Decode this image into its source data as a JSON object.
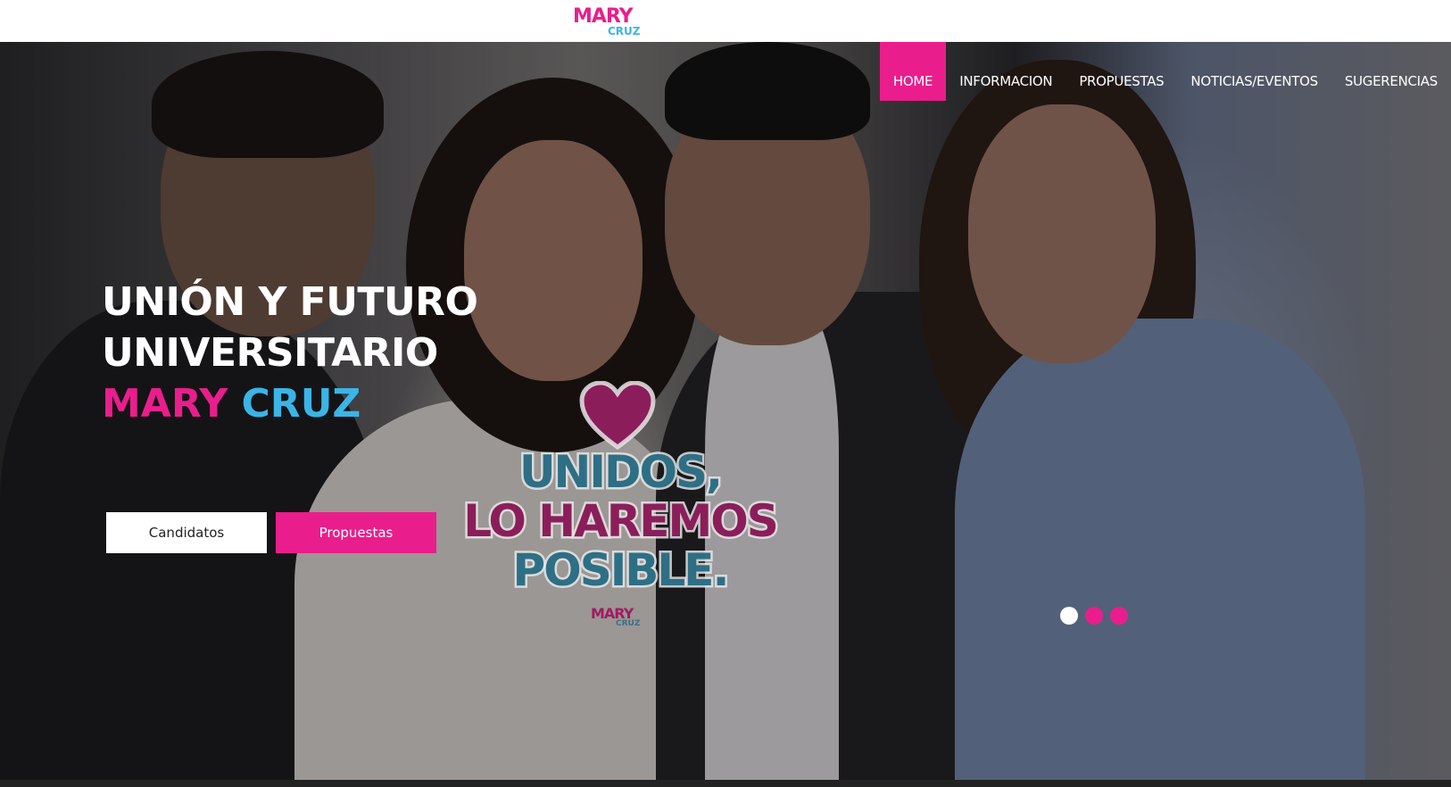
{
  "colors": {
    "brand_pink": "#e91e8c",
    "brand_blue": "#3bb4e6",
    "slogan_teal": "#2e6f86",
    "slogan_magenta": "#8b1e5a"
  },
  "header": {
    "logo_line1": "MARY",
    "logo_line2": "CRUZ"
  },
  "nav": {
    "items": [
      {
        "label": "HOME",
        "active": true
      },
      {
        "label": "INFORMACION",
        "active": false
      },
      {
        "label": "PROPUESTAS",
        "active": false
      },
      {
        "label": "NOTICIAS/EVENTOS",
        "active": false
      },
      {
        "label": "SUGERENCIAS",
        "active": false
      }
    ]
  },
  "hero": {
    "line1": "UNIÓN Y FUTURO",
    "line2": "UNIVERSITARIO",
    "name_first": "MARY",
    "name_last": "CRUZ",
    "button_primary": "Candidatos",
    "button_secondary": "Propuestas",
    "slogan_line1": "UNIDOS,",
    "slogan_line2": "LO HAREMOS",
    "slogan_line3": "POSIBLE.",
    "slogan_logo_line1": "MARY",
    "slogan_logo_line2": "CRUZ",
    "heart_icon": "heart-icon"
  },
  "slider": {
    "count": 3,
    "active_index": 0,
    "colors": [
      "#ffffff",
      "#e91e8c",
      "#e91e8c"
    ]
  }
}
